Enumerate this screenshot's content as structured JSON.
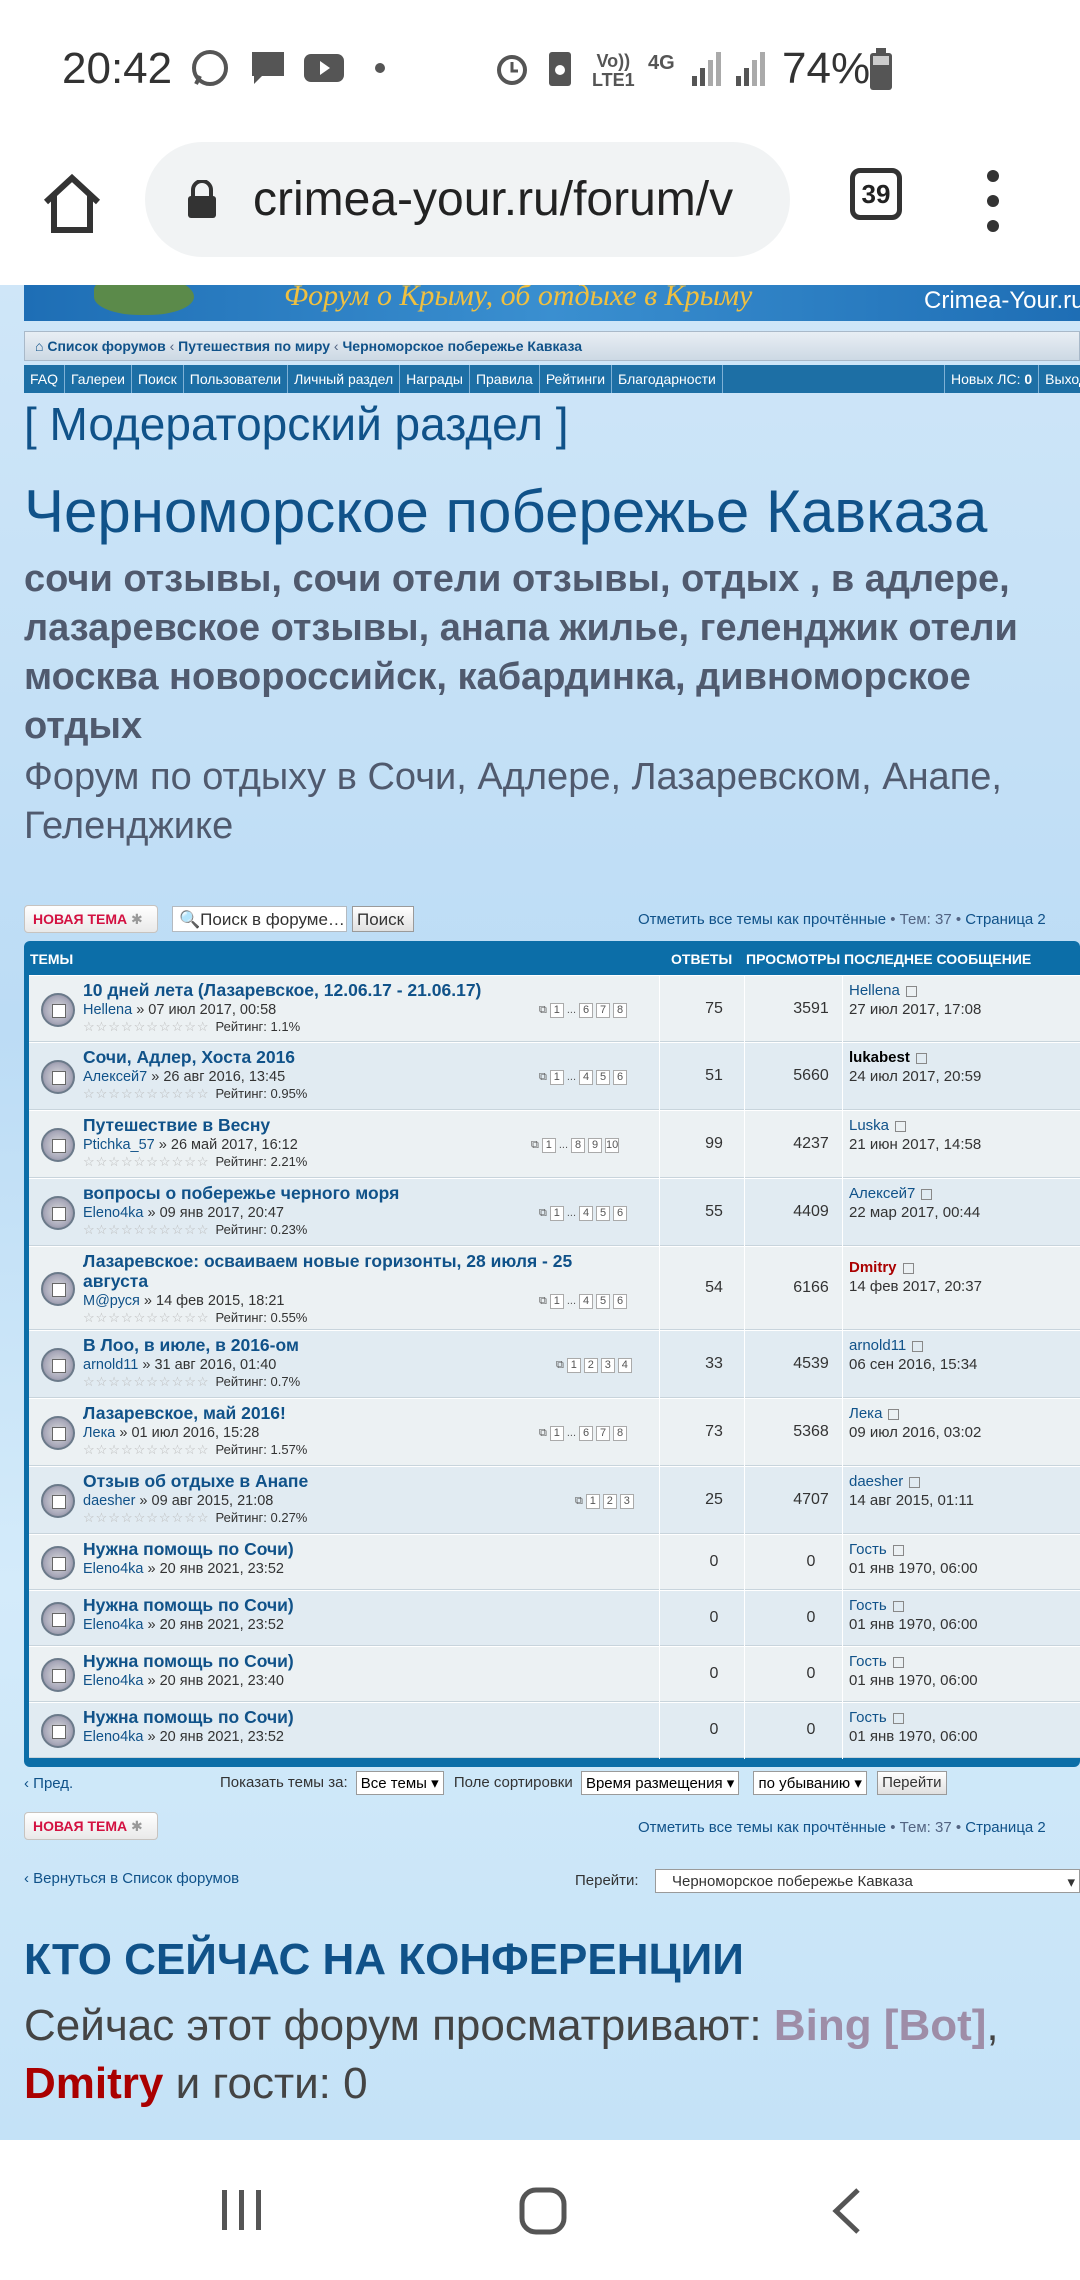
{
  "status": {
    "time": "20:42",
    "network": "LTE1",
    "network_top": "Vo))",
    "net_type": "4G",
    "battery": "74%"
  },
  "browser": {
    "url": "crimea-your.ru/forum/v",
    "tabs_count": "39"
  },
  "banner": {
    "title": "Форум о Крыму, об отдыхе в Крыму",
    "site": "Crimea-Your.ru"
  },
  "breadcrumbs": [
    "Список форумов",
    "Путешествия по миру",
    "Черноморское побережье Кавказа"
  ],
  "nav": {
    "items": [
      "FAQ",
      "Галереи",
      "Поиск",
      "Пользователи",
      "Личный раздел",
      "Награды",
      "Правила",
      "Рейтинги",
      "Благодарности"
    ],
    "new_pm_label": "Новых ЛС:",
    "new_pm_count": "0",
    "exit": "Выход"
  },
  "mod_title": "[ Модераторский раздел ]",
  "forum": {
    "title": "Черноморское побережье Кавказа",
    "desc": "сочи отзывы, сочи отели отзывы, отдых , в адлере, лазаревское отзывы, анапа жилье, геленджик отели москва новороссийск, кабардинка, дивноморское отдых",
    "sub": "Форум по отдыху в Сочи, Адлере, Лазаревском, Анапе, Геленджике"
  },
  "actions": {
    "new_topic": "НОВАЯ ТЕМА",
    "search_placeholder": "Поиск в форуме…",
    "search_button": "Поиск",
    "mark_read": "Отметить все темы как прочтённые",
    "topics_count": "Тем: 37",
    "page": "Страница 2"
  },
  "table": {
    "headers": {
      "topics": "ТЕМЫ",
      "answers": "ОТВЕТЫ",
      "views": "ПРОСМОТРЫ",
      "last_post": "ПОСЛЕДНЕЕ СООБЩЕНИЕ"
    },
    "rows": [
      {
        "title": "10 дней лета (Лазаревское, 12.06.17 - 21.06.17)",
        "author": "Hellena",
        "date": "07 июл 2017, 00:58",
        "rating": "Рейтинг: 1.1%",
        "pages": [
          "1",
          "...",
          "6",
          "7",
          "8"
        ],
        "answers": "75",
        "views": "3591",
        "last_author": "Hellena",
        "last_date": "27 июл 2017, 17:08"
      },
      {
        "title": "Сочи, Адлер, Хоста 2016",
        "author": "Алексей7",
        "date": "26 авг 2016, 13:45",
        "rating": "Рейтинг: 0.95%",
        "pages": [
          "1",
          "...",
          "4",
          "5",
          "6"
        ],
        "answers": "51",
        "views": "5660",
        "last_author": "lukabest",
        "last_date": "24 июл 2017, 20:59"
      },
      {
        "title": "Путешествие в Весну",
        "author": "Ptichka_57",
        "date": "26 май 2017, 16:12",
        "rating": "Рейтинг: 2.21%",
        "pages": [
          "1",
          "...",
          "8",
          "9",
          "10"
        ],
        "answers": "99",
        "views": "4237",
        "last_author": "Luska",
        "last_date": "21 июн 2017, 14:58"
      },
      {
        "title": "вопросы о побережье черного моря",
        "author": "Eleno4ka",
        "date": "09 янв 2017, 20:47",
        "rating": "Рейтинг: 0.23%",
        "pages": [
          "1",
          "...",
          "4",
          "5",
          "6"
        ],
        "answers": "55",
        "views": "4409",
        "last_author": "Алексей7",
        "last_date": "22 мар 2017, 00:44"
      },
      {
        "title": "Лазаревское: осваиваем новые горизонты, 28 июля - 25",
        "title2": "августа",
        "author": "M@руся",
        "date": "14 фев 2015, 18:21",
        "rating": "Рейтинг: 0.55%",
        "pages": [
          "1",
          "...",
          "4",
          "5",
          "6"
        ],
        "answers": "54",
        "views": "6166",
        "last_author": "Dmitry",
        "last_date": "14 фев 2017, 20:37"
      },
      {
        "title": "В Лоо, в июле, в 2016-ом",
        "author": "arnold11",
        "date": "31 авг 2016, 01:40",
        "rating": "Рейтинг: 0.7%",
        "pages": [
          "1",
          "2",
          "3",
          "4"
        ],
        "answers": "33",
        "views": "4539",
        "last_author": "arnold11",
        "last_date": "06 сен 2016, 15:34"
      },
      {
        "title": "Лазаревское, май 2016!",
        "author": "Лека",
        "date": "01 июл 2016, 15:28",
        "rating": "Рейтинг: 1.57%",
        "pages": [
          "1",
          "...",
          "6",
          "7",
          "8"
        ],
        "answers": "73",
        "views": "5368",
        "last_author": "Лека",
        "last_date": "09 июл 2016, 03:02"
      },
      {
        "title": "Отзыв об отдыхе в Анапе",
        "author": "daesher",
        "date": "09 авг 2015, 21:08",
        "rating": "Рейтинг: 0.27%",
        "pages": [
          "1",
          "2",
          "3"
        ],
        "answers": "25",
        "views": "4707",
        "last_author": "daesher",
        "last_date": "14 авг 2015, 01:11"
      },
      {
        "title": "Нужна помощь по Сочи)",
        "author": "Eleno4ka",
        "date": "20 янв 2021, 23:52",
        "answers": "0",
        "views": "0",
        "last_author": "Гость",
        "last_date": "01 янв 1970, 06:00"
      },
      {
        "title": "Нужна помощь по Сочи)",
        "author": "Eleno4ka",
        "date": "20 янв 2021, 23:52",
        "answers": "0",
        "views": "0",
        "last_author": "Гость",
        "last_date": "01 янв 1970, 06:00"
      },
      {
        "title": "Нужна помощь по Сочи)",
        "author": "Eleno4ka",
        "date": "20 янв 2021, 23:40",
        "answers": "0",
        "views": "0",
        "last_author": "Гость",
        "last_date": "01 янв 1970, 06:00"
      },
      {
        "title": "Нужна помощь по Сочи)",
        "author": "Eleno4ka",
        "date": "20 янв 2021, 23:52",
        "answers": "0",
        "views": "0",
        "last_author": "Гость",
        "last_date": "01 янв 1970, 06:00"
      }
    ]
  },
  "sort": {
    "prev": "Пред.",
    "show_label": "Показать темы за:",
    "show_value": "Все темы",
    "sort_label": "Поле сортировки",
    "sort_value": "Время размещения",
    "order_value": "по убыванию",
    "go_button": "Перейти"
  },
  "footer": {
    "return_link": "Вернуться в Список форумов",
    "jump_label": "Перейти:",
    "jump_value": "Черноморское побережье Кавказа"
  },
  "who": {
    "title": "КТО СЕЙЧАС НА КОНФЕРЕНЦИИ",
    "prefix": "Сейчас этот форум просматривают: ",
    "bot": "Bing [Bot]",
    "comma": ",",
    "admin": "Dmitry",
    "suffix": " и гости: 0"
  },
  "colors": {
    "accent": "#105289",
    "header_bar": "#0c6ea8",
    "new_topic": "#d31141",
    "admin": "#aa0000",
    "bot": "#9e8da7"
  }
}
